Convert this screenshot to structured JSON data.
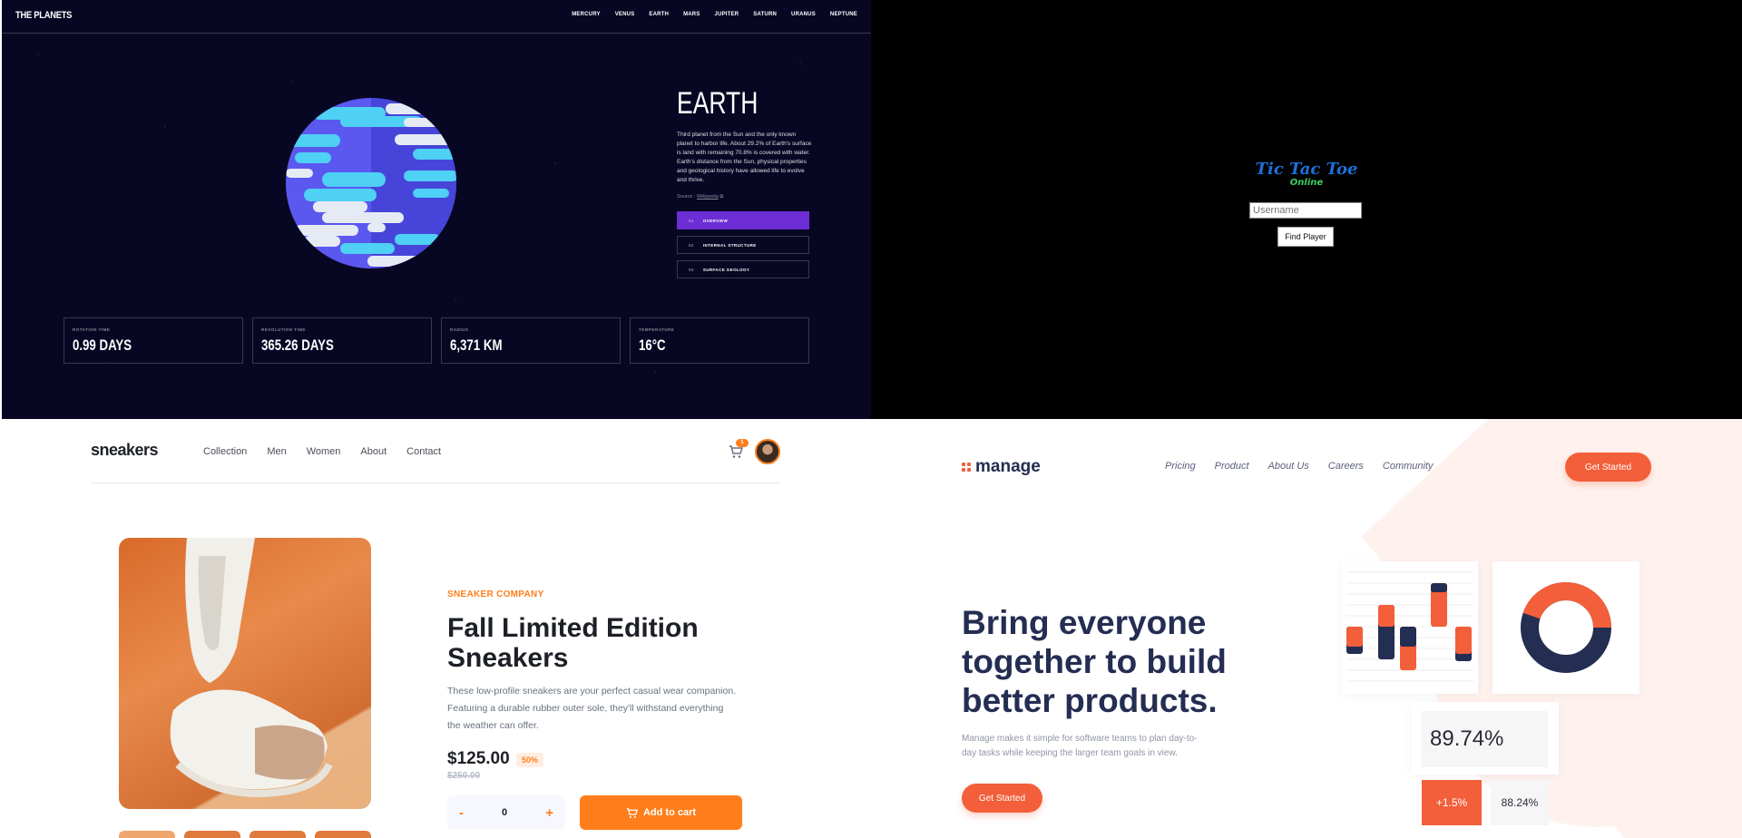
{
  "planets": {
    "logo": "THE PLANETS",
    "nav": [
      "MERCURY",
      "VENUS",
      "EARTH",
      "MARS",
      "JUPITER",
      "SATURN",
      "URANUS",
      "NEPTUNE"
    ],
    "title": "EARTH",
    "description": "Third planet from the Sun and the only known planet to harbor life. About 29.2% of Earth's surface is land with remaining 70.8% is covered with water. Earth's distance from the Sun, physical properties and geological history have allowed life to evolve and thrive.",
    "source_label": "Source :",
    "source_link": "Wikipedia",
    "tabs": [
      {
        "num": "01",
        "label": "OVERVIEW"
      },
      {
        "num": "02",
        "label": "INTERNAL STRUCTURE"
      },
      {
        "num": "03",
        "label": "SURFACE GEOLOGY"
      }
    ],
    "active_tab": 0,
    "stats": [
      {
        "label": "ROTATION TIME",
        "value": "0.99 DAYS"
      },
      {
        "label": "REVOLUTION TIME",
        "value": "365.26 DAYS"
      },
      {
        "label": "RADIUS",
        "value": "6,371 KM"
      },
      {
        "label": "TEMPERATURE",
        "value": "16°C"
      }
    ],
    "colors": {
      "bg": "#070724",
      "active_tab": "#6d2ed5"
    }
  },
  "ttt": {
    "title": "Tic Tac Toe",
    "subtitle": "Online",
    "username_placeholder": "Username",
    "button": "Find Player"
  },
  "sneakers": {
    "logo": "sneakers",
    "nav": [
      "Collection",
      "Men",
      "Women",
      "About",
      "Contact"
    ],
    "cart_count": "1",
    "company": "SNEAKER COMPANY",
    "title": "Fall Limited Edition Sneakers",
    "description": "These low-profile sneakers are your perfect casual wear companion. Featuring a durable rubber outer sole, they'll withstand everything the weather can offer.",
    "price": "$125.00",
    "discount": "50%",
    "old_price": "$250.00",
    "qty_minus": "-",
    "qty": "0",
    "qty_plus": "+",
    "add_to_cart": "Add to cart",
    "accent": "#ff7e1b"
  },
  "manage": {
    "logo": "manage",
    "nav": [
      "Pricing",
      "Product",
      "About Us",
      "Careers",
      "Community"
    ],
    "cta": "Get Started",
    "headline": "Bring everyone together to build better products.",
    "description": "Manage makes it simple for software teams to plan day-to-day tasks while keeping the larger team goals in view.",
    "cta2": "Get Started",
    "stat_big": "89.74%",
    "stat_badge": "+1.5%",
    "stat_small": "88.24%",
    "accent": "#f25f3a",
    "navy": "#242d52"
  }
}
